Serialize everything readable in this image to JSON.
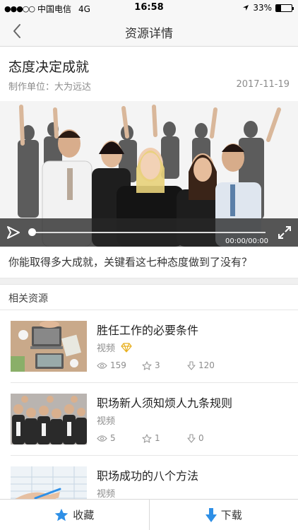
{
  "status_bar": {
    "signal": "●●●○○",
    "carrier": "中国电信",
    "network": "4G",
    "time": "16:58",
    "battery_percent": "33%",
    "battery_level": 0.33
  },
  "nav": {
    "title": "资源详情"
  },
  "resource": {
    "title": "态度决定成就",
    "producer": "制作单位：大为远达",
    "date": "2017-11-19",
    "description": "你能取得多大成就，关键看这七种态度做到了没有？"
  },
  "video": {
    "time": "00:00/00:00",
    "progress": 0
  },
  "related": {
    "heading": "相关资源",
    "items": [
      {
        "title": "胜任工作的必要条件",
        "type": "视频",
        "views": "159",
        "stars": "3",
        "downloads": "120",
        "premium": true,
        "thumb": "laptop-desk"
      },
      {
        "title": "职场新人须知烦人九条规则",
        "type": "视频",
        "views": "5",
        "stars": "1",
        "downloads": "0",
        "premium": false,
        "thumb": "crowd"
      },
      {
        "title": "职场成功的八个方法",
        "type": "视频",
        "views": "",
        "stars": "",
        "downloads": "",
        "premium": false,
        "thumb": "writing"
      }
    ]
  },
  "bottom": {
    "favorite_label": "收藏",
    "download_label": "下载"
  },
  "colors": {
    "accent": "#2e8fe6",
    "gold": "#e8b020",
    "muted": "#8c8c8c"
  }
}
